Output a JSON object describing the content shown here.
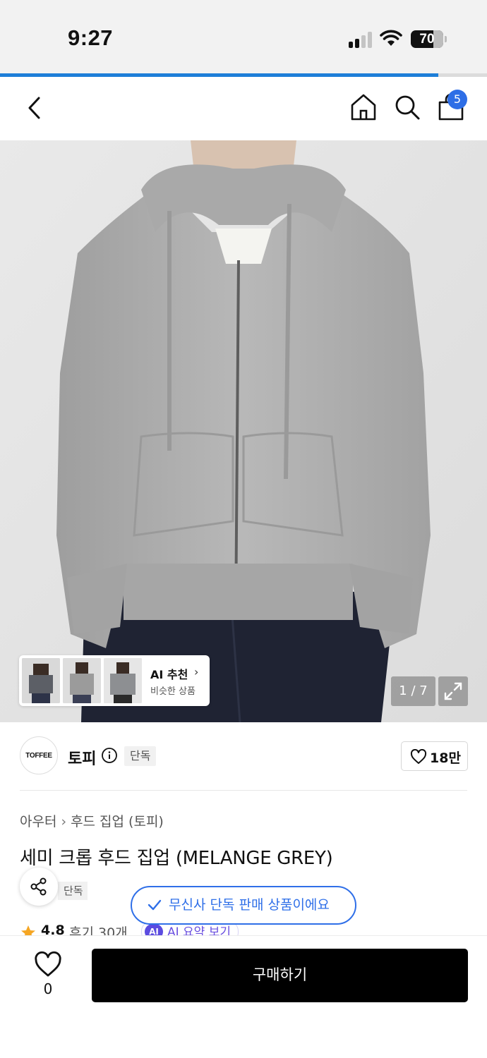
{
  "status_bar": {
    "time": "9:27",
    "battery": "70"
  },
  "nav": {
    "cart_count": "5"
  },
  "product_image": {
    "counter": "1 / 7"
  },
  "ai_recommend": {
    "title": "AI 추천",
    "subtitle": "비슷한 상품"
  },
  "brand": {
    "logo_text": "TOFFEE",
    "name": "토피",
    "tag": "단독",
    "likes": "18만"
  },
  "breadcrumb": [
    "아우터",
    "후드 집업 (토피)"
  ],
  "product": {
    "title": "세미 크롭 후드 집업 (MELANGE GREY)",
    "sub_tag": "단독",
    "rating": "4.8",
    "reviews": "후기 30개",
    "ai_summary": "AI 요약 보기",
    "ai_badge": "AI"
  },
  "toast": "무신사 단독 판매 상품이에요",
  "bottom_bar": {
    "like_count": "0",
    "buy_label": "구매하기"
  },
  "colors": {
    "accent_blue": "#2f6fe8",
    "progress_blue": "#1d7ed8",
    "ai_purple": "#5b4be0"
  },
  "load_progress": 0.9
}
